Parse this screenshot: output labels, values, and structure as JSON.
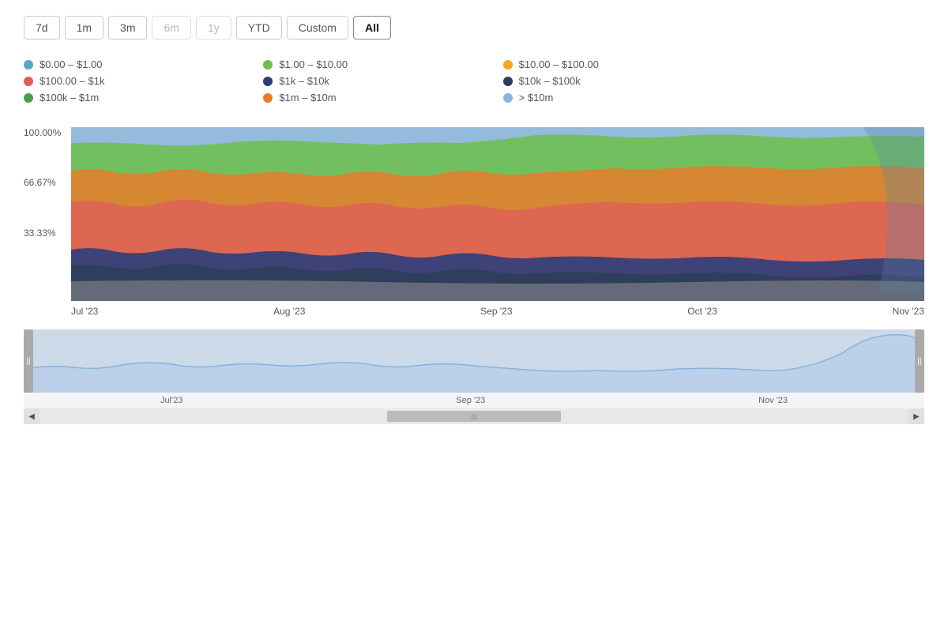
{
  "timeButtons": [
    {
      "label": "7d",
      "state": "normal"
    },
    {
      "label": "1m",
      "state": "normal"
    },
    {
      "label": "3m",
      "state": "normal"
    },
    {
      "label": "6m",
      "state": "disabled"
    },
    {
      "label": "1y",
      "state": "disabled"
    },
    {
      "label": "YTD",
      "state": "normal"
    },
    {
      "label": "Custom",
      "state": "normal"
    },
    {
      "label": "All",
      "state": "active"
    }
  ],
  "legend": [
    {
      "label": "$0.00 – $1.00",
      "color": "#5ba4cf"
    },
    {
      "label": "$1.00 – $10.00",
      "color": "#6cc04a"
    },
    {
      "label": "$10.00 – $100.00",
      "color": "#f5a623"
    },
    {
      "label": "$100.00 – $1k",
      "color": "#e05c5c"
    },
    {
      "label": "$1k – $10k",
      "color": "#2c3e7a"
    },
    {
      "label": "$10k – $100k",
      "color": "#2c3e5a"
    },
    {
      "label": "$100k – $1m",
      "color": "#4c9a4c"
    },
    {
      "label": "$1m – $10m",
      "color": "#e87c2a"
    },
    {
      "label": "> $10m",
      "color": "#8ab4d8"
    }
  ],
  "yAxisLabels": [
    "100.00%",
    "66.67%",
    "33.33%",
    ""
  ],
  "xAxisLabels": [
    "Jul '23",
    "Aug '23",
    "Sep '23",
    "Oct '23",
    "Nov '23"
  ],
  "navXLabels": [
    "Jul'23",
    "Sep '23",
    "Nov '23"
  ],
  "handles": {
    "left": "||",
    "right": "||"
  },
  "scrollbar": {
    "left": "◀",
    "right": "▶",
    "thumb": "|||"
  }
}
